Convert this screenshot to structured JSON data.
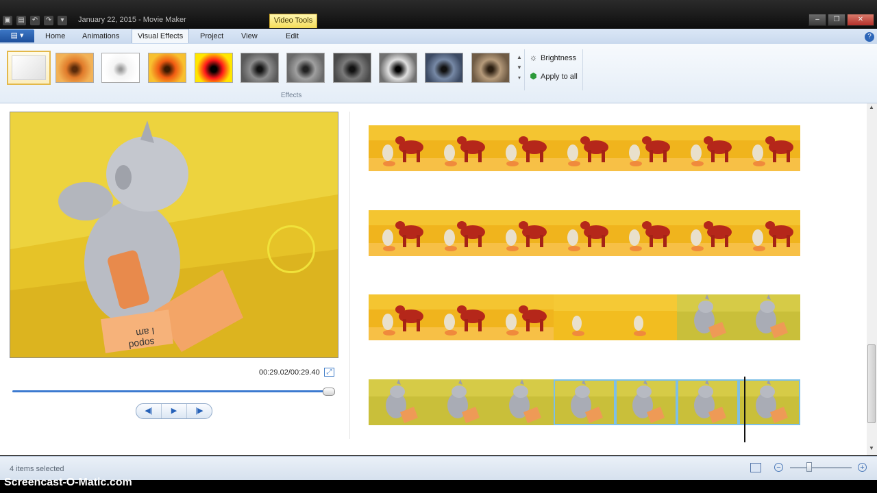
{
  "window": {
    "title": "January 22, 2015 - Movie Maker",
    "contextual_group": "Video Tools",
    "controls": {
      "minimize": "–",
      "maximize": "❐",
      "close": "✕"
    }
  },
  "quick_access": {
    "icons": [
      "movie-icon",
      "save-icon",
      "undo-icon",
      "redo-icon",
      "customize-icon"
    ]
  },
  "tabs": {
    "file_menu": "▤ ▾",
    "items": [
      "Home",
      "Animations",
      "Visual Effects",
      "Project",
      "View",
      "Edit"
    ],
    "active": "Visual Effects"
  },
  "ribbon": {
    "effects_group_label": "Effects",
    "effects": [
      {
        "name": "No effect",
        "tone": "blank"
      },
      {
        "name": "Warm",
        "tone": "warm"
      },
      {
        "name": "Sketch",
        "tone": "sketch"
      },
      {
        "name": "Orange tint",
        "tone": "orange"
      },
      {
        "name": "Threshold",
        "tone": "threshold"
      },
      {
        "name": "Black and white",
        "tone": "gray1"
      },
      {
        "name": "Black and white 2",
        "tone": "gray2"
      },
      {
        "name": "Black and white 3",
        "tone": "gray3"
      },
      {
        "name": "Edge",
        "tone": "gray4"
      },
      {
        "name": "Cyanotype",
        "tone": "cyan"
      },
      {
        "name": "Sepia",
        "tone": "sepia"
      }
    ],
    "commands": {
      "brightness": "Brightness",
      "apply_to_all": "Apply to all"
    }
  },
  "preview": {
    "time": "00:29.02/00:29.40",
    "progress": 0.987,
    "transport": {
      "previous": "◀|",
      "play": "▶",
      "next": "|▶"
    }
  },
  "storyboard": {
    "rows": [
      {
        "frames": [
          "red-horse",
          "red-horse",
          "red-horse",
          "red-horse",
          "red-horse",
          "red-horse",
          "red-horse"
        ]
      },
      {
        "frames": [
          "red-horse",
          "red-horse",
          "red-horse",
          "red-horse",
          "red-horse",
          "red-horse",
          "red-horse"
        ]
      },
      {
        "frames": [
          "red-horse",
          "red-horse",
          "red-horse",
          "yellow",
          "yellow",
          "gray-pony",
          "gray-pony"
        ]
      },
      {
        "frames": [
          "gray-pony",
          "gray-pony",
          "gray-pony",
          "gray-pony",
          "gray-pony",
          "gray-pony",
          "gray-pony"
        ],
        "selected": [
          3,
          4,
          5,
          6
        ]
      }
    ]
  },
  "status": {
    "text": "4 items selected"
  },
  "zoom": {
    "out": "−",
    "in": "+",
    "level": 0.3
  },
  "watermark": "Screencast-O-Matic.com"
}
